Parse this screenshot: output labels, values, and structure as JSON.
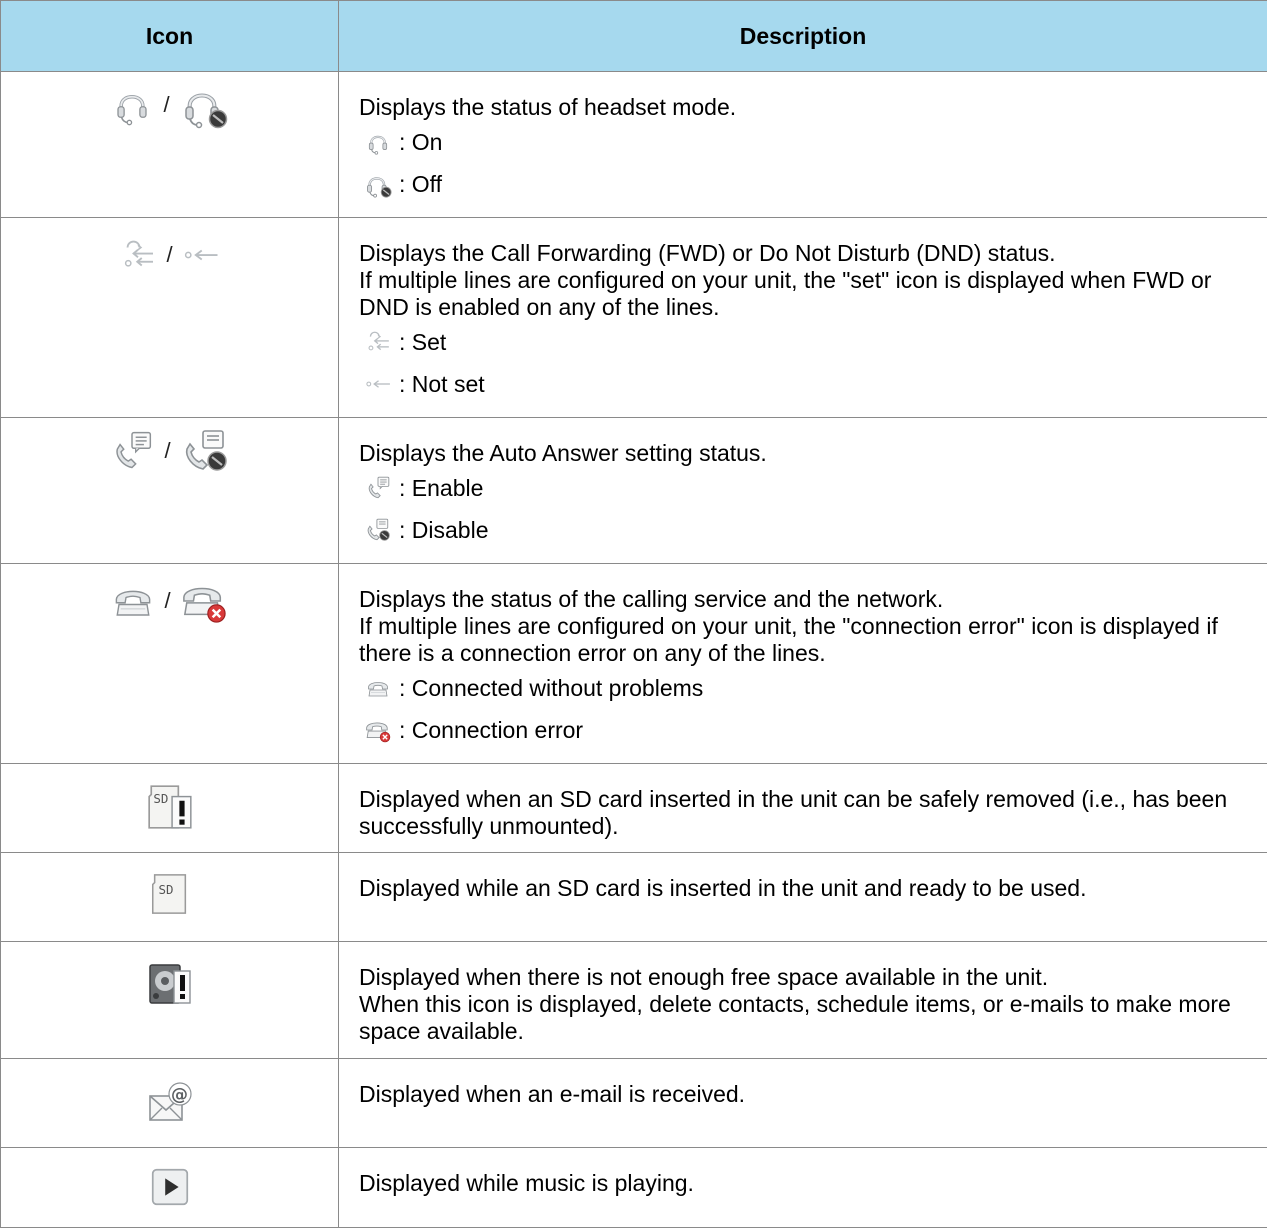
{
  "header": {
    "col_icon": "Icon",
    "col_description": "Description"
  },
  "rows": [
    {
      "name": "headset",
      "icons": [
        "headset-icon",
        "headset-off-icon"
      ],
      "separator": "/",
      "desc": [
        "Displays the status of headset mode."
      ],
      "legend": [
        {
          "icon": "headset-icon",
          "label": ": On"
        },
        {
          "icon": "headset-off-icon",
          "label": ": Off"
        }
      ]
    },
    {
      "name": "fwd-dnd",
      "icons": [
        "fwd-dnd-set-icon",
        "fwd-dnd-notset-icon"
      ],
      "separator": "/",
      "desc": [
        "Displays the Call Forwarding (FWD) or Do Not Disturb (DND) status.",
        "If multiple lines are configured on your unit, the \"set\" icon is displayed when FWD or DND is enabled on any of the lines."
      ],
      "legend": [
        {
          "icon": "fwd-dnd-set-icon",
          "label": ": Set"
        },
        {
          "icon": "fwd-dnd-notset-icon",
          "label": ": Not set"
        }
      ]
    },
    {
      "name": "auto-answer",
      "icons": [
        "auto-answer-icon",
        "auto-answer-disabled-icon"
      ],
      "separator": "/",
      "desc": [
        "Displays the Auto Answer setting status."
      ],
      "legend": [
        {
          "icon": "auto-answer-icon",
          "label": ": Enable"
        },
        {
          "icon": "auto-answer-disabled-icon",
          "label": ": Disable"
        }
      ]
    },
    {
      "name": "connection",
      "icons": [
        "phone-connected-icon",
        "phone-connection-error-icon"
      ],
      "separator": "/",
      "desc": [
        "Displays the status of the calling service and the network.",
        "If multiple lines are configured on your unit, the \"connection error\" icon is displayed if there is a connection error on any of the lines."
      ],
      "legend": [
        {
          "icon": "phone-connected-icon",
          "label": ": Connected without problems"
        },
        {
          "icon": "phone-connection-error-icon",
          "label": ": Connection error"
        }
      ]
    },
    {
      "name": "sd-remove",
      "icons": [
        "sd-card-warning-icon"
      ],
      "desc": [
        "Displayed when an SD card inserted in the unit can be safely removed (i.e., has been successfully unmounted)."
      ]
    },
    {
      "name": "sd-ready",
      "icons": [
        "sd-card-icon"
      ],
      "desc": [
        "Displayed while an SD card is inserted in the unit and ready to be used."
      ]
    },
    {
      "name": "storage-full",
      "icons": [
        "storage-full-icon"
      ],
      "desc": [
        "Displayed when there is not enough free space available in the unit.",
        "When this icon is displayed, delete contacts, schedule items, or e-mails to make more space available."
      ]
    },
    {
      "name": "email",
      "icons": [
        "email-received-icon"
      ],
      "desc": [
        "Displayed when an e-mail is received."
      ]
    },
    {
      "name": "music",
      "icons": [
        "music-playing-icon"
      ],
      "desc": [
        "Displayed while music is playing."
      ]
    }
  ]
}
